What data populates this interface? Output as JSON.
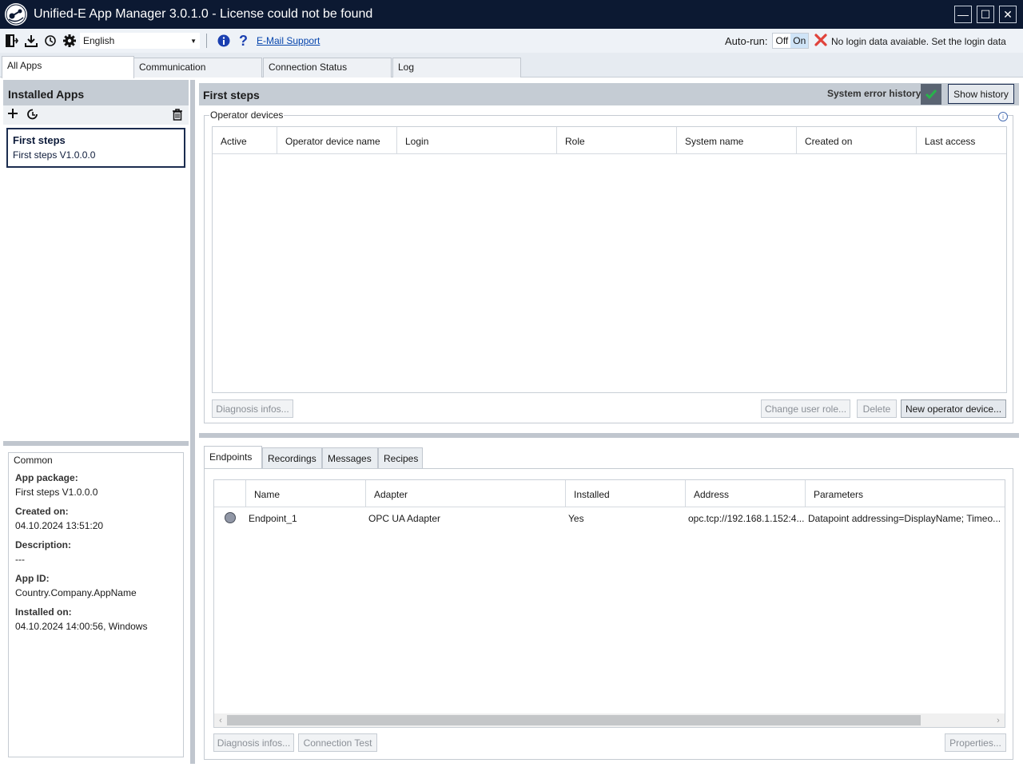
{
  "window": {
    "title": "Unified-E App Manager 3.0.1.0 - License could not be found",
    "minimize_glyph": "—",
    "maximize_glyph": "☐",
    "close_glyph": "✕"
  },
  "toolbar": {
    "language": "English",
    "email_support": "E-Mail Support",
    "autorun_label": "Auto-run:",
    "autorun_off": "Off",
    "autorun_on": "On",
    "autorun_value": "On",
    "login_message": "No login data avaiable. Set the login data",
    "icons": [
      "exit-icon",
      "download-icon",
      "history-icon",
      "settings-gear-icon",
      "info-icon",
      "help-icon",
      "error-x-icon"
    ]
  },
  "main_tabs": [
    {
      "label": "All Apps",
      "active": true
    },
    {
      "label": "Communication",
      "active": false
    },
    {
      "label": "Connection Status",
      "active": false
    },
    {
      "label": "Log",
      "active": false
    }
  ],
  "left": {
    "header": "Installed Apps",
    "app": {
      "title": "First steps",
      "subtitle": "First steps V1.0.0.0"
    },
    "common": {
      "title": "Common",
      "props": [
        {
          "key": "App package:",
          "value": "First steps V1.0.0.0"
        },
        {
          "key": "Created on:",
          "value": "04.10.2024 13:51:20"
        },
        {
          "key": "Description:",
          "value": "---"
        },
        {
          "key": "App ID:",
          "value": "Country.Company.AppName"
        },
        {
          "key": "Installed on:",
          "value": "04.10.2024 14:00:56, Windows"
        }
      ]
    }
  },
  "right": {
    "header": "First steps",
    "error_history_label": "System error history:",
    "error_history_status": "ok",
    "show_history": "Show history",
    "operator_devices": {
      "title": "Operator devices",
      "columns": [
        "Active",
        "Operator device name",
        "Login",
        "Role",
        "System name",
        "Created on",
        "Last access"
      ],
      "rows": [],
      "buttons": {
        "diagnosis": "Diagnosis infos...",
        "change_role": "Change user role...",
        "delete": "Delete",
        "new_device": "New operator device..."
      }
    },
    "bottom_tabs": [
      {
        "label": "Endpoints",
        "active": true
      },
      {
        "label": "Recordings",
        "active": false
      },
      {
        "label": "Messages",
        "active": false
      },
      {
        "label": "Recipes",
        "active": false
      }
    ],
    "endpoints": {
      "columns": [
        "",
        "Name",
        "Adapter",
        "Installed",
        "Address",
        "Parameters"
      ],
      "rows": [
        {
          "name": "Endpoint_1",
          "adapter": "OPC UA Adapter",
          "installed": "Yes",
          "address": "opc.tcp://192.168.1.152:4...",
          "parameters": "Datapoint addressing=DisplayName; Timeo..."
        }
      ],
      "buttons": {
        "diagnosis": "Diagnosis infos...",
        "connection_test": "Connection Test",
        "properties": "Properties..."
      }
    }
  }
}
